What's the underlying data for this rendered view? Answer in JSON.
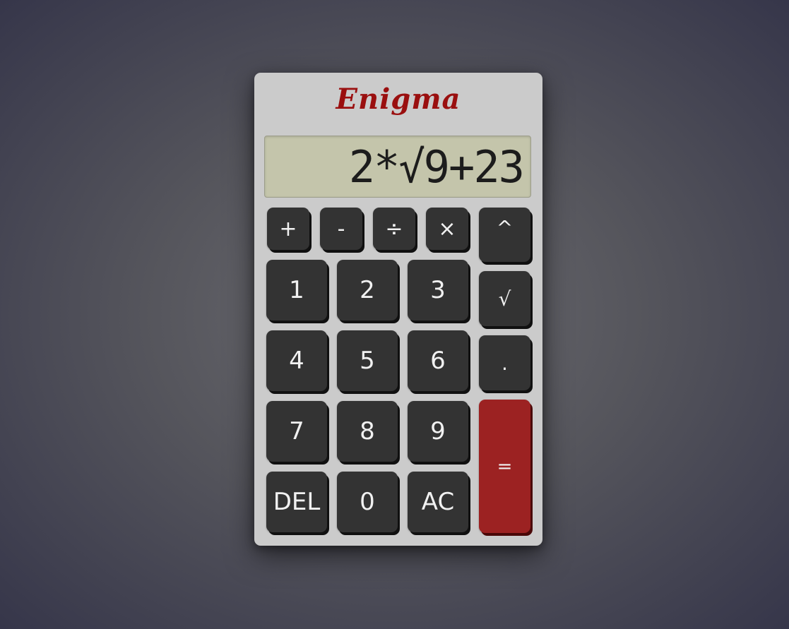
{
  "brand": "Enigma",
  "display": {
    "expression": "2*√9+23"
  },
  "keys": {
    "plus": "+",
    "minus": "-",
    "divide": "÷",
    "multiply": "×",
    "power": "^",
    "sqrt": "√",
    "decimal": ".",
    "one": "1",
    "two": "2",
    "three": "3",
    "four": "4",
    "five": "5",
    "six": "6",
    "seven": "7",
    "eight": "8",
    "nine": "9",
    "zero": "0",
    "delete": "DEL",
    "clear": "AC",
    "equals": "="
  },
  "colors": {
    "brand": "#9a0f0f",
    "body": "#cbcbcb",
    "display_bg": "#c4c5ab",
    "key": "#333333",
    "equals_key": "#9c2222"
  }
}
